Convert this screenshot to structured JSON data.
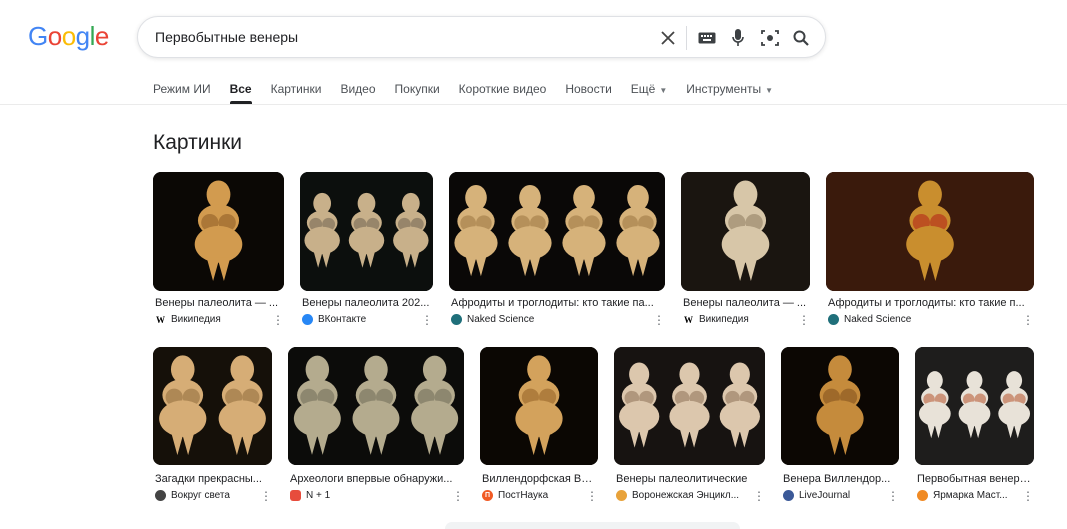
{
  "logo": {
    "letters": [
      "G",
      "o",
      "o",
      "g",
      "l",
      "e"
    ],
    "colors": [
      "#4285F4",
      "#EA4335",
      "#FBBC05",
      "#4285F4",
      "#34A853",
      "#EA4335"
    ]
  },
  "search": {
    "query": "Первобытные венеры"
  },
  "tabs": [
    {
      "label": "Режим ИИ",
      "active": false
    },
    {
      "label": "Все",
      "active": true
    },
    {
      "label": "Картинки",
      "active": false
    },
    {
      "label": "Видео",
      "active": false
    },
    {
      "label": "Покупки",
      "active": false
    },
    {
      "label": "Короткие видео",
      "active": false
    },
    {
      "label": "Новости",
      "active": false
    },
    {
      "label": "Ещё",
      "active": false,
      "dropdown": true
    },
    {
      "label": "Инструменты",
      "active": false,
      "dropdown": true
    }
  ],
  "images_section": {
    "title": "Картинки",
    "row1": [
      {
        "caption": "Венеры палеолита — ...",
        "source": "Википедия",
        "favicon": "W",
        "favicon_color": "#ffffff"
      },
      {
        "caption": "Венеры палеолита 202...",
        "source": "ВКонтакте",
        "favicon": "vk",
        "favicon_color": "#2787F5"
      },
      {
        "caption": "Афродиты и троглодиты: кто такие па...",
        "source": "Naked Science",
        "favicon": "ns",
        "favicon_color": "#1f6f7a"
      },
      {
        "caption": "Венеры палеолита — ...",
        "source": "Википедия",
        "favicon": "W",
        "favicon_color": "#ffffff"
      },
      {
        "caption": "Афродиты и троглодиты: кто такие п...",
        "source": "Naked Science",
        "favicon": "ns",
        "favicon_color": "#1f6f7a"
      }
    ],
    "row2": [
      {
        "caption": "Загадки прекрасны...",
        "source": "Вокруг света",
        "favicon": "vs",
        "favicon_color": "#444444"
      },
      {
        "caption": "Археологи впервые обнаружи...",
        "source": "N + 1",
        "favicon": "N+1",
        "favicon_color": "#e74c3c"
      },
      {
        "caption": "Виллендорфская Ве...",
        "source": "ПостНаука",
        "favicon": "П",
        "favicon_color": "#f15a24"
      },
      {
        "caption": "Венеры палеолитические",
        "source": "Воронежская Энцикл...",
        "favicon": "vo",
        "favicon_color": "#e8a23a"
      },
      {
        "caption": "Венера Виллендор...",
        "source": "LiveJournal",
        "favicon": "lj",
        "favicon_color": "#3b5998"
      },
      {
        "caption": "Первобытная венера...",
        "source": "Ярмарка Маст...",
        "favicon": "ym",
        "favicon_color": "#f08a24"
      }
    ]
  }
}
